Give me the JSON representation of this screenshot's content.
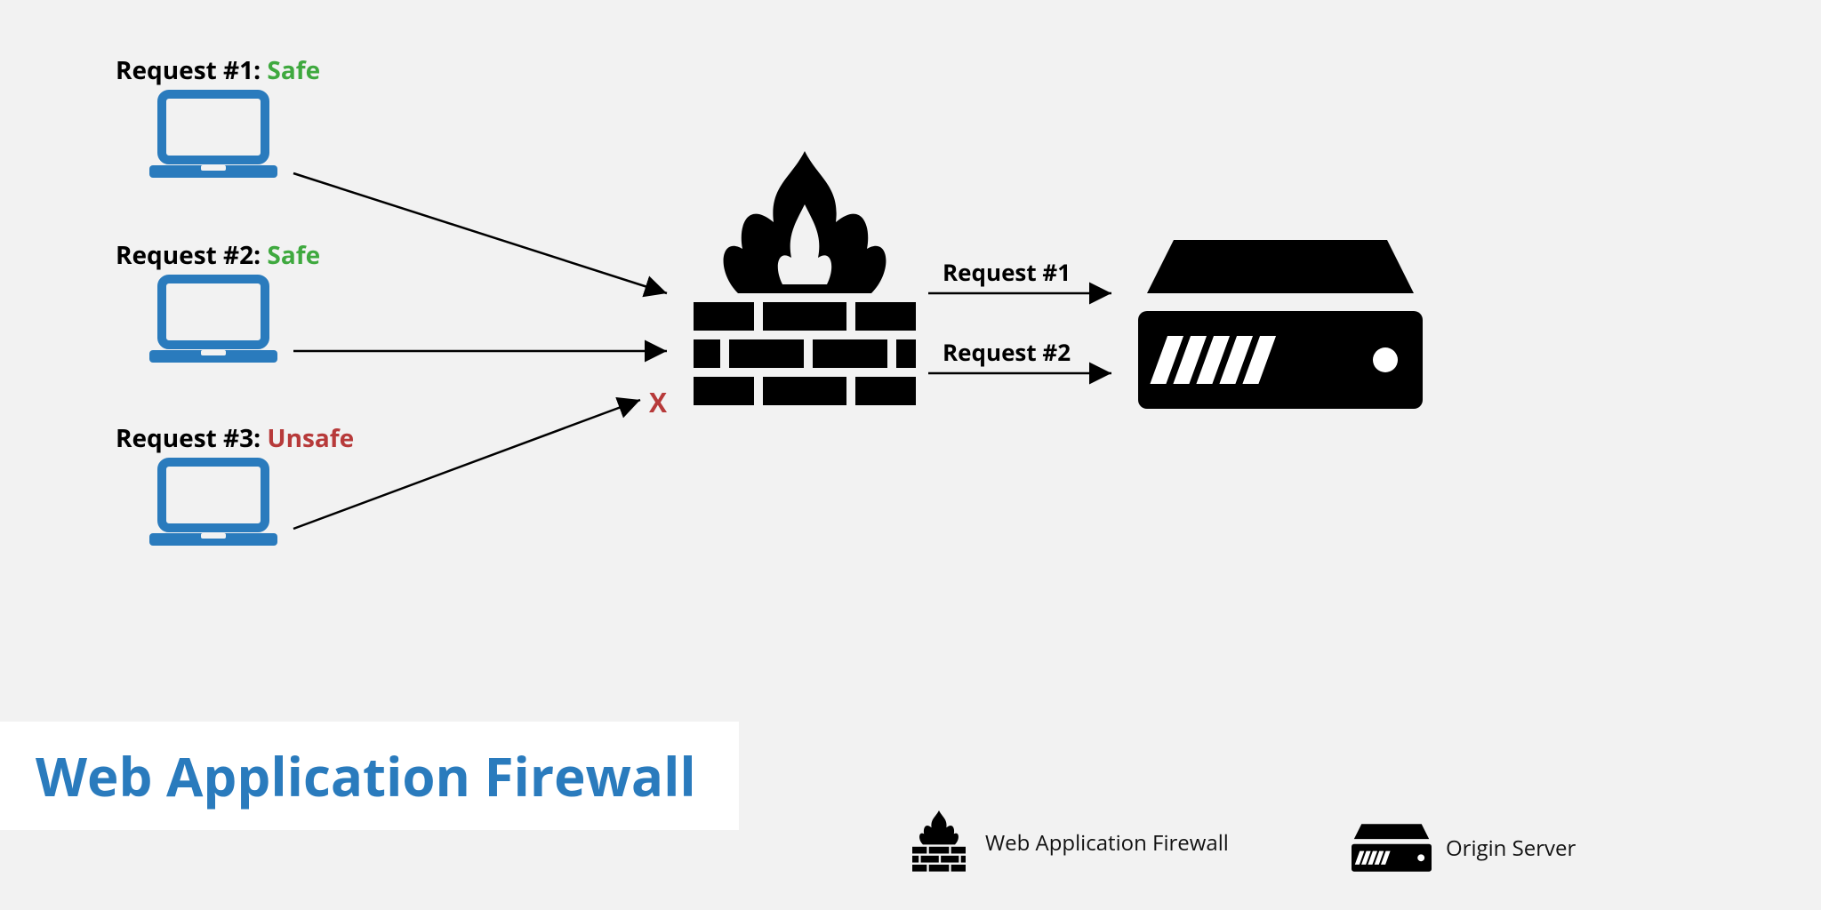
{
  "requests": [
    {
      "label_prefix": "Request #1:",
      "status_text": "Safe",
      "status": "safe"
    },
    {
      "label_prefix": "Request #2:",
      "status_text": "Safe",
      "status": "safe"
    },
    {
      "label_prefix": "Request #3:",
      "status_text": "Unsafe",
      "status": "unsafe"
    }
  ],
  "passed_labels": {
    "r1": "Request #1",
    "r2": "Request #2"
  },
  "block_marker": "X",
  "title": "Web Application Firewall",
  "legend": {
    "firewall": "Web Application Firewall",
    "server": "Origin Server"
  },
  "colors": {
    "laptop": "#2a7bbd",
    "safe": "#3fa93f",
    "unsafe": "#b73a3a",
    "title": "#2a7bbd"
  }
}
